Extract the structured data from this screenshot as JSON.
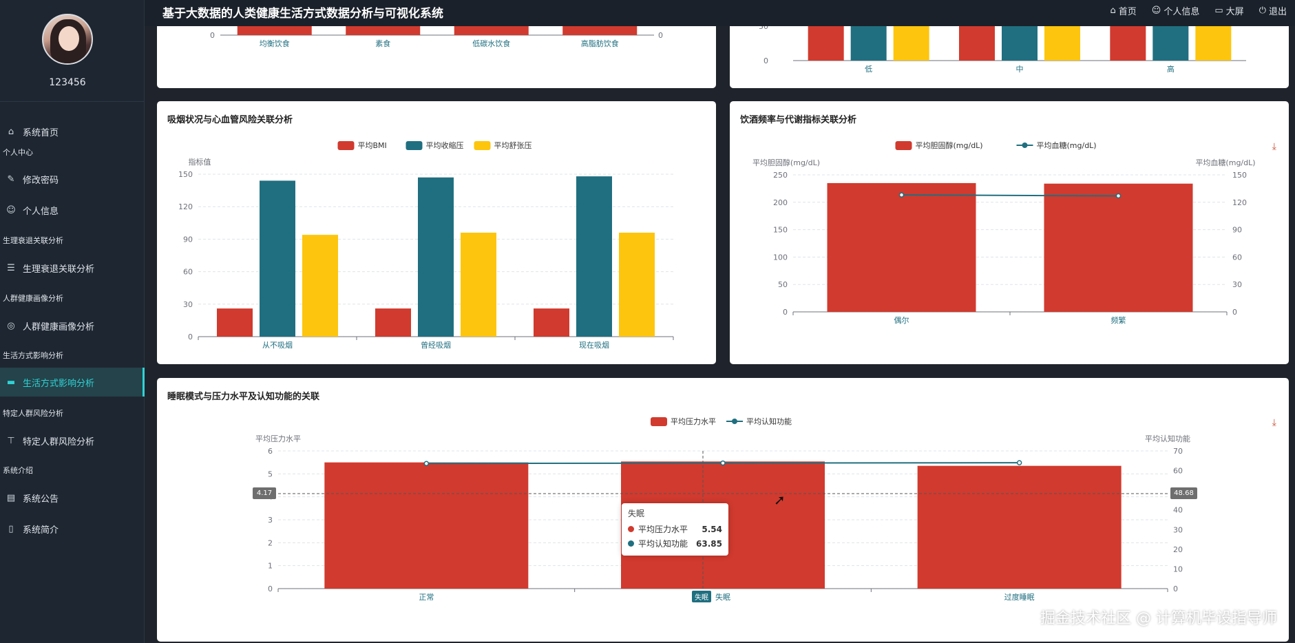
{
  "app": {
    "title": "基于大数据的人类健康生活方式数据分析与可视化系统"
  },
  "user": {
    "name": "123456"
  },
  "top_nav": [
    {
      "label": "首页",
      "icon": "home-icon",
      "glyph": "⌂"
    },
    {
      "label": "个人信息",
      "icon": "user-icon",
      "glyph": "☺"
    },
    {
      "label": "大屏",
      "icon": "monitor-icon",
      "glyph": "▭"
    },
    {
      "label": "退出",
      "icon": "power-icon",
      "glyph": "⏻"
    }
  ],
  "sidebar": {
    "home": {
      "label": "系统首页",
      "icon": "home-icon",
      "glyph": "⌂"
    },
    "groups": [
      {
        "group": "个人中心",
        "items": [
          {
            "label": "修改密码",
            "icon": "edit-icon",
            "glyph": "✎"
          },
          {
            "label": "个人信息",
            "icon": "user-icon",
            "glyph": "☺"
          }
        ]
      },
      {
        "group": "生理衰退关联分析",
        "items": [
          {
            "label": "生理衰退关联分析",
            "icon": "sliders-icon",
            "glyph": "☰"
          }
        ]
      },
      {
        "group": "人群健康画像分析",
        "items": [
          {
            "label": "人群健康画像分析",
            "icon": "compass-icon",
            "glyph": "◎"
          }
        ]
      },
      {
        "group": "生活方式影响分析",
        "items": [
          {
            "label": "生活方式影响分析",
            "icon": "monitor-icon",
            "glyph": "▬",
            "active": true
          }
        ]
      },
      {
        "group": "特定人群风险分析",
        "items": [
          {
            "label": "特定人群风险分析",
            "icon": "filter-icon",
            "glyph": "⊤"
          }
        ]
      },
      {
        "group": "系统介绍",
        "items": [
          {
            "label": "系统公告",
            "icon": "notice-icon",
            "glyph": "▤"
          },
          {
            "label": "系统简介",
            "icon": "info-icon",
            "glyph": "▯"
          }
        ]
      }
    ]
  },
  "colors": {
    "red": "#d13a2e",
    "teal": "#206f80",
    "yellow": "#fdc50d",
    "active": "#2fd3d6"
  },
  "chart_data": [
    {
      "id": "diet-partial",
      "type": "bar",
      "categories": [
        "均衡饮食",
        "素食",
        "低碳水饮食",
        "高脂肪饮食"
      ],
      "y_ticks_visible": [
        "0"
      ],
      "y2_ticks_visible": [
        "0"
      ]
    },
    {
      "id": "level-partial",
      "type": "bar",
      "categories": [
        "低",
        "中",
        "高"
      ],
      "y_ticks_visible": [
        "50",
        "0"
      ]
    },
    {
      "id": "smoking",
      "type": "bar",
      "title": "吸烟状况与心血管风险关联分析",
      "categories": [
        "从不吸烟",
        "曾经吸烟",
        "现在吸烟"
      ],
      "ylabel": "指标值",
      "ylim": [
        0,
        150
      ],
      "yticks": [
        0,
        30,
        60,
        90,
        120,
        150
      ],
      "series": [
        {
          "name": "平均BMI",
          "values": [
            26,
            26,
            26
          ],
          "color": "#d13a2e"
        },
        {
          "name": "平均收缩压",
          "values": [
            144,
            147,
            148
          ],
          "color": "#206f80"
        },
        {
          "name": "平均舒张压",
          "values": [
            94,
            96,
            96
          ],
          "color": "#fdc50d"
        }
      ],
      "legend": "top-center",
      "grid": true
    },
    {
      "id": "drinking",
      "type": "bar+line",
      "title": "饮酒频率与代谢指标关联分析",
      "categories": [
        "偶尔",
        "频繁"
      ],
      "ylabel": "平均胆固醇(mg/dL)",
      "y2label": "平均血糖(mg/dL)",
      "ylim": [
        0,
        250
      ],
      "yticks": [
        0,
        50,
        100,
        150,
        200,
        250
      ],
      "y2lim": [
        0,
        150
      ],
      "y2ticks": [
        0,
        30,
        60,
        90,
        120,
        150
      ],
      "series": [
        {
          "name": "平均胆固醇(mg/dL)",
          "kind": "bar",
          "values": [
            235,
            234
          ],
          "color": "#d13a2e"
        },
        {
          "name": "平均血糖(mg/dL)",
          "kind": "line",
          "values": [
            128,
            127
          ],
          "color": "#206f80"
        }
      ],
      "legend": "top-center",
      "grid": true
    },
    {
      "id": "sleep",
      "type": "bar+line",
      "title": "睡眠模式与压力水平及认知功能的关联",
      "categories": [
        "正常",
        "失眠",
        "过度睡眠"
      ],
      "ylabel": "平均压力水平",
      "y2label": "平均认知功能",
      "ylim": [
        0,
        6
      ],
      "yticks": [
        0,
        1,
        2,
        3,
        4,
        5,
        6
      ],
      "y2lim": [
        0,
        70
      ],
      "y2ticks": [
        0,
        10,
        20,
        30,
        40,
        50,
        60,
        70
      ],
      "series": [
        {
          "name": "平均压力水平",
          "kind": "bar",
          "values": [
            5.5,
            5.54,
            5.35
          ],
          "color": "#d13a2e"
        },
        {
          "name": "平均认知功能",
          "kind": "line",
          "values": [
            63.6,
            63.85,
            64.0
          ],
          "color": "#206f80"
        }
      ],
      "legend": "top-center",
      "grid": true,
      "crosshair": {
        "y_left_label": "4.17",
        "y_right_label": "48.68",
        "x_label": "失眠"
      },
      "tooltip": {
        "title": "失眠",
        "rows": [
          {
            "name": "平均压力水平",
            "value": "5.54",
            "color": "#d13a2e"
          },
          {
            "name": "平均认知功能",
            "value": "63.85",
            "color": "#206f80"
          }
        ]
      }
    }
  ],
  "watermark": "掘金技术社区 @ 计算机毕设指导师"
}
